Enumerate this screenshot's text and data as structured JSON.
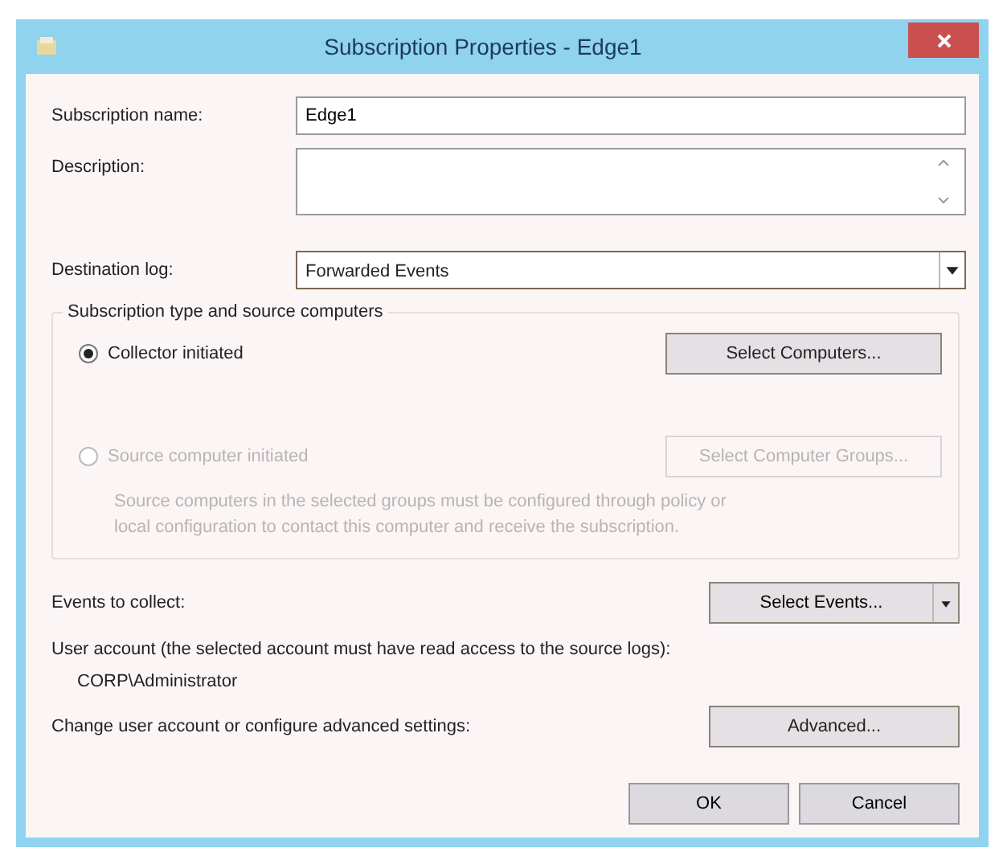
{
  "window": {
    "title": "Subscription Properties - Edge1"
  },
  "fields": [
    {
      "kind": "text",
      "label": "Subscription name:",
      "value": "Edge1"
    },
    {
      "kind": "textarea",
      "label": "Description:"
    },
    {
      "kind": "dropdown",
      "label": "Destination log:",
      "value": "Forwarded Events"
    }
  ],
  "source_group": {
    "legend": "Subscription type and source computers",
    "options": [
      {
        "label": "Collector initiated",
        "selected": true,
        "disabled": false,
        "button": "Select Computers..."
      },
      {
        "label": "Source computer initiated",
        "selected": false,
        "disabled": true,
        "button": "Select Computer Groups...",
        "note": "Source computers in the selected groups must be configured through policy or local configuration to contact this computer and receive the subscription."
      }
    ]
  },
  "events": {
    "label": "Events to collect:",
    "button": "Select Events..."
  },
  "user_account": {
    "label": "User account (the selected account must have read access to the source logs):",
    "value": "CORP\\Administrator"
  },
  "advanced": {
    "label": "Change user account or configure advanced settings:",
    "button": "Advanced..."
  },
  "buttons": [
    "OK",
    "Cancel"
  ]
}
